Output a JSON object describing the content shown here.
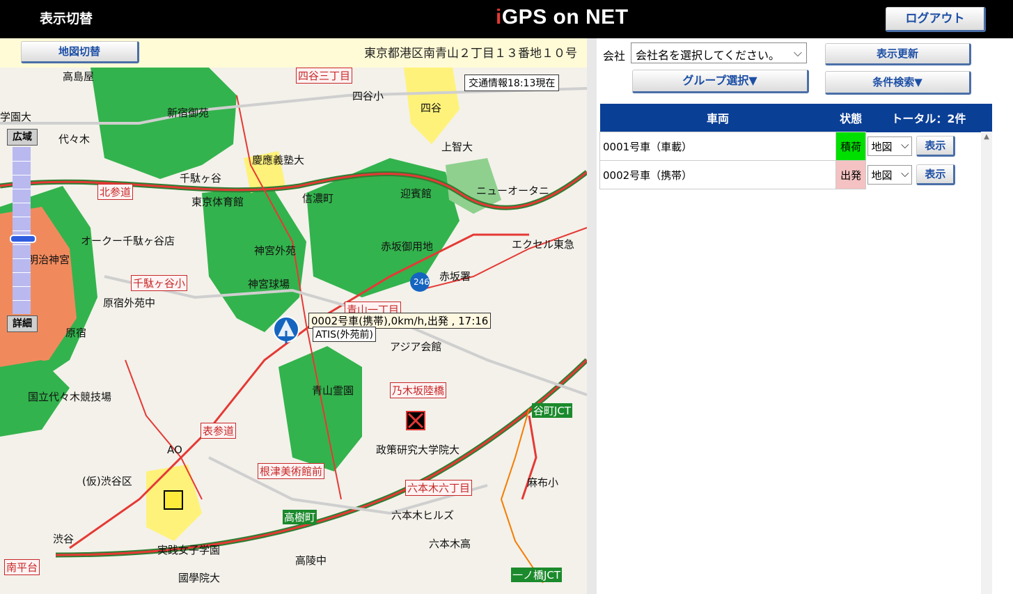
{
  "header": {
    "display_toggle": "表示切替",
    "logo_i": "i",
    "logo_rest": "GPS on NET",
    "logout": "ログアウト"
  },
  "map": {
    "switch_button": "地図切替",
    "address": "東京都港区南青山２丁目１３番地１０号",
    "traffic_info": "交通情報18:13現在",
    "zoom_wide": "広域",
    "zoom_detail": "詳細",
    "vehicle_popup": "0002号車(携帯),0km/h,出発 , 17:16",
    "station_label": "ATIS(外苑前)",
    "labels": [
      "高島屋",
      "四谷三丁目",
      "四谷",
      "四谷小",
      "新宿御苑",
      "学園大",
      "代々木",
      "慶應義塾大",
      "上智大",
      "千駄ヶ谷",
      "北参道",
      "東京体育館",
      "信濃町",
      "迎賓館",
      "ニューオータニ",
      "オークー千駄ヶ谷店",
      "明治神宮",
      "神宮外苑",
      "赤坂御用地",
      "エクセル東急",
      "神宮球場",
      "赤坂署",
      "千駄ヶ谷小",
      "原宿外苑中",
      "原宿",
      "青山一丁目",
      "アジア会館",
      "国立代々木競技場",
      "青山霊園",
      "乃木坂陸橋",
      "表参道",
      "谷町JCT",
      "政策研究大学院大",
      "AO",
      "根津美術館前",
      "(仮)渋谷区",
      "麻布小",
      "六本木六丁目",
      "高樹町",
      "六本木ヒルズ",
      "渋谷",
      "実践女子学園",
      "六本木高",
      "高陵中",
      "南平台",
      "國學院大",
      "一ノ橋JCT",
      "246"
    ]
  },
  "panel": {
    "company_label": "会社",
    "company_placeholder": "会社名を選択してください。",
    "refresh": "表示更新",
    "group_select": "グループ選択▼",
    "condition_search": "条件検索▼",
    "columns": {
      "vehicle": "車両",
      "status": "状態",
      "total": "トータル：2件"
    },
    "rows": [
      {
        "vehicle": "0001号車（車載）",
        "status": "積荷",
        "status_color": "#00e000",
        "map_select": "地図",
        "show": "表示"
      },
      {
        "vehicle": "0002号車（携帯）",
        "status": "出発",
        "status_color": "#f4c2c2",
        "map_select": "地図",
        "show": "表示"
      }
    ]
  },
  "icons": [
    "chevron-down-icon",
    "vehicle-marker-icon",
    "scroll-up-icon"
  ]
}
